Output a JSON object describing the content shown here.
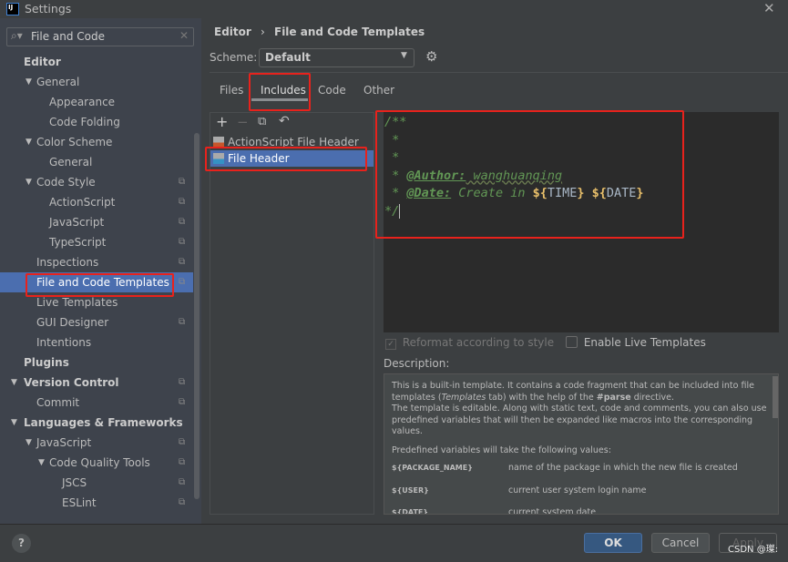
{
  "window": {
    "title": "Settings",
    "close_icon": "close-icon"
  },
  "search": {
    "value": "File and Code"
  },
  "sidebar": {
    "items": [
      {
        "label": "Editor",
        "level": 0,
        "bold": true
      },
      {
        "label": "General",
        "level": 1,
        "expanded": true
      },
      {
        "label": "Appearance",
        "level": 2
      },
      {
        "label": "Code Folding",
        "level": 2
      },
      {
        "label": "Color Scheme",
        "level": 1,
        "expanded": true
      },
      {
        "label": "General",
        "level": 2
      },
      {
        "label": "Code Style",
        "level": 1,
        "expanded": true,
        "copy": true
      },
      {
        "label": "ActionScript",
        "level": 2,
        "copy": true
      },
      {
        "label": "JavaScript",
        "level": 2,
        "copy": true
      },
      {
        "label": "TypeScript",
        "level": 2,
        "copy": true
      },
      {
        "label": "Inspections",
        "level": 1,
        "copy": true
      },
      {
        "label": "File and Code Templates",
        "level": 1,
        "copy": true,
        "selected": true
      },
      {
        "label": "Live Templates",
        "level": 1
      },
      {
        "label": "GUI Designer",
        "level": 1,
        "copy": true
      },
      {
        "label": "Intentions",
        "level": 1
      },
      {
        "label": "Plugins",
        "level": 0,
        "bold": true
      },
      {
        "label": "Version Control",
        "level": 0,
        "bold": true,
        "expanded": true,
        "copy": true
      },
      {
        "label": "Commit",
        "level": 1,
        "copy": true
      },
      {
        "label": "Languages & Frameworks",
        "level": 0,
        "bold": true,
        "expanded": true
      },
      {
        "label": "JavaScript",
        "level": 1,
        "expanded": true,
        "copy": true
      },
      {
        "label": "Code Quality Tools",
        "level": 2,
        "expanded": true,
        "copy": true
      },
      {
        "label": "JSCS",
        "level": 3,
        "copy": true
      },
      {
        "label": "ESLint",
        "level": 3,
        "copy": true
      }
    ]
  },
  "breadcrumb": {
    "parent": "Editor",
    "separator": "›",
    "current": "File and Code Templates"
  },
  "scheme": {
    "label": "Scheme:",
    "value": "Default"
  },
  "tabs": [
    {
      "label": "Files"
    },
    {
      "label": "Includes",
      "active": true
    },
    {
      "label": "Code"
    },
    {
      "label": "Other"
    }
  ],
  "toolbar": {
    "add": "+",
    "remove": "−"
  },
  "templates": [
    {
      "label": "ActionScript File Header"
    },
    {
      "label": "File Header",
      "selected": true
    }
  ],
  "editor": {
    "l1": "/**",
    "l2": " *",
    "l3": " *",
    "l4_star": " * ",
    "l4_tag": "@Author:",
    "l4_text": " wanghuanqing",
    "l5_star": " * ",
    "l5_tag": "@Date:",
    "l5_text": " Create in ",
    "v1_open": "${",
    "v1": "TIME",
    "close": "}",
    "v2_open": "${",
    "v2": "DATE",
    "l6": "*/"
  },
  "options": {
    "reformat": {
      "label": "Reformat according to style",
      "checked": true,
      "disabled": true
    },
    "live": {
      "label": "Enable Live Templates",
      "checked": false
    }
  },
  "description": {
    "label": "Description:",
    "p1a": "This is a built-in template. It contains a code fragment that can be included into file templates (",
    "p1i": "Templates",
    "p1b": " tab) with the help of the ",
    "p1c": "#parse",
    "p1d": " directive.",
    "p2": "The template is editable. Along with static text, code and comments, you can also use predefined variables that will then be expanded like macros into the corresponding values.",
    "p3": "Predefined variables will take the following values:",
    "vars": [
      {
        "name": "${PACKAGE_NAME}",
        "desc": "name of the package in which the new file is created"
      },
      {
        "name": "${USER}",
        "desc": "current user system login name"
      },
      {
        "name": "${DATE}",
        "desc": "current system date"
      }
    ]
  },
  "buttons": {
    "ok": "OK",
    "cancel": "Cancel",
    "apply": "Apply",
    "help": "?"
  },
  "watermark": "CSDN @璨:",
  "colors": {
    "selection": "#4b6eaf",
    "ok": "#365880",
    "annotation": "#e8221c"
  }
}
